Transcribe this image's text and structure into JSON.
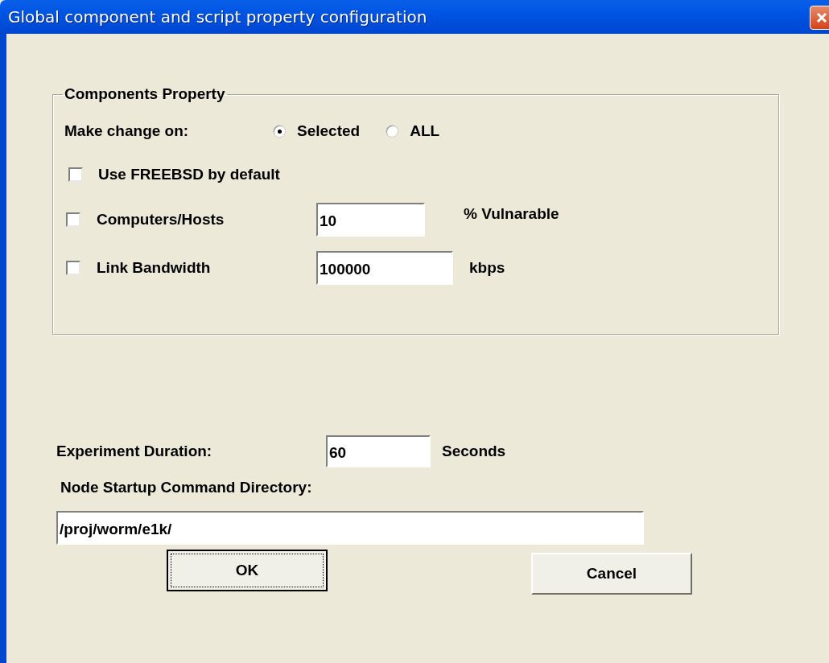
{
  "window": {
    "title": "Global component and script property configuration"
  },
  "components_group": {
    "title": "Components Property",
    "make_change_label": "Make change on:",
    "options": [
      {
        "label": "Selected",
        "selected": true
      },
      {
        "label": "ALL",
        "selected": false
      }
    ],
    "rows": [
      {
        "kind": "checkbox",
        "label": "Use FREEBSD by default",
        "checked": false
      },
      {
        "kind": "checkbox_field",
        "label": "Computers/Hosts",
        "checked": false,
        "value": "10",
        "unit": "% Vulnarable"
      },
      {
        "kind": "checkbox_field",
        "label": "Link Bandwidth",
        "checked": false,
        "value": "100000",
        "unit": "kbps"
      }
    ]
  },
  "experiment_duration": {
    "label": "Experiment Duration:",
    "value": "60",
    "unit": "Seconds"
  },
  "startup_directory": {
    "label": "Node Startup Command Directory:",
    "value": "/proj/worm/e1k/"
  },
  "buttons": [
    {
      "label": "OK",
      "default": true
    },
    {
      "label": "Cancel",
      "default": false
    }
  ]
}
